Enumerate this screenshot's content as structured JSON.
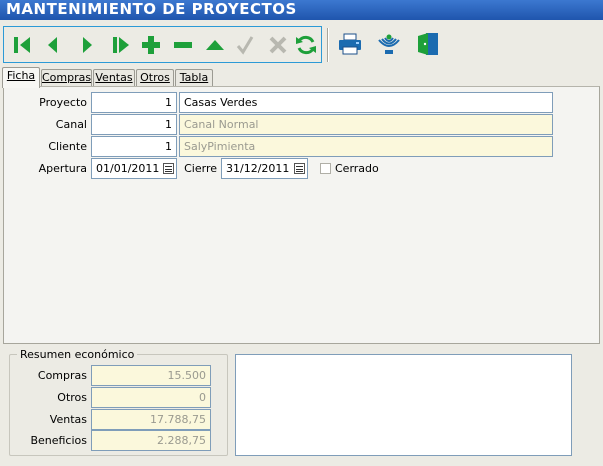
{
  "window": {
    "title": "MANTENIMIENTO DE PROYECTOS"
  },
  "toolbar": {
    "icons": [
      "first-icon",
      "prev-icon",
      "next-icon",
      "last-icon",
      "add-icon",
      "delete-icon",
      "up-icon",
      "check-icon",
      "cancel-icon",
      "refresh-icon",
      "print-icon",
      "signal-icon",
      "exit-icon"
    ],
    "colors": {
      "nav": "#1ea03a",
      "disabled": "#b8b8b0",
      "accent": "#1b6bb0",
      "border": "#2c9ad6"
    }
  },
  "tabs": [
    {
      "label": "Ficha",
      "active": true
    },
    {
      "label": "Compras",
      "active": false
    },
    {
      "label": "Ventas",
      "active": false
    },
    {
      "label": "Otros",
      "active": false
    },
    {
      "label": "Tabla",
      "active": false
    }
  ],
  "form": {
    "proyecto": {
      "label": "Proyecto",
      "code": "1",
      "name": "Casas Verdes"
    },
    "canal": {
      "label": "Canal",
      "code": "1",
      "name": "Canal Normal"
    },
    "cliente": {
      "label": "Cliente",
      "code": "1",
      "name": "SalyPimienta"
    },
    "apertura": {
      "label": "Apertura",
      "value": "01/01/2011"
    },
    "cierre": {
      "label": "Cierre",
      "value": "31/12/2011"
    },
    "cerrado": {
      "label": "Cerrado",
      "checked": false
    }
  },
  "resumen": {
    "title": "Resumen económico",
    "compras": {
      "label": "Compras",
      "value": "15.500"
    },
    "otros": {
      "label": "Otros",
      "value": "0"
    },
    "ventas": {
      "label": "Ventas",
      "value": "17.788,75"
    },
    "beneficios": {
      "label": "Beneficios",
      "value": "2.288,75"
    }
  }
}
